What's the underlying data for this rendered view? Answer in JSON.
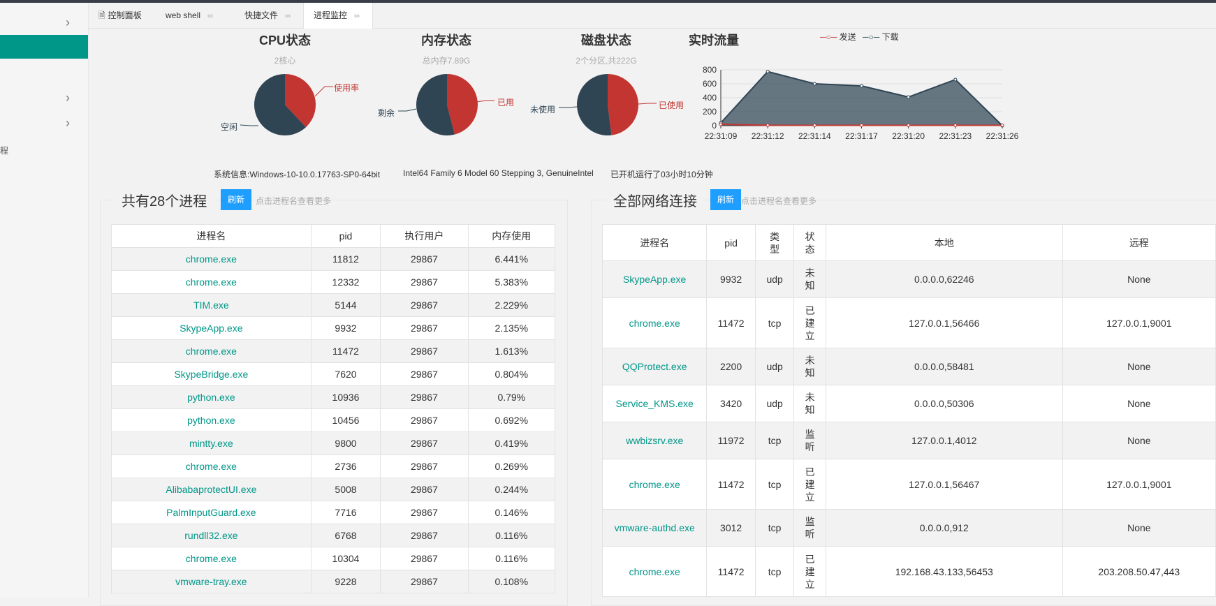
{
  "tabs": [
    {
      "label": "控制面板"
    },
    {
      "label": "web shell"
    },
    {
      "label": "快捷文件"
    },
    {
      "label": "进程监控"
    }
  ],
  "sidebar": {
    "partial_label": "程"
  },
  "cpu": {
    "title": "CPU状态",
    "subtitle": "2核心",
    "used_label": "使用率",
    "free_label": "空闲",
    "used_fraction": 0.38,
    "used_color": "#c23531",
    "free_color": "#2f4554"
  },
  "memory": {
    "title": "内存状态",
    "subtitle": "总内存7.89G",
    "used_label": "已用",
    "free_label": "剩余",
    "used_fraction": 0.46,
    "used_color": "#c23531",
    "free_color": "#2f4554"
  },
  "disk": {
    "title": "磁盘状态",
    "subtitle": "2个分区,共222G",
    "used_label": "已使用",
    "free_label": "未使用",
    "used_fraction": 0.48,
    "used_color": "#c23531",
    "free_color": "#2f4554"
  },
  "traffic": {
    "title": "实时流量",
    "legend_send": "发送",
    "legend_download": "下载"
  },
  "chart_data": {
    "type": "area",
    "x": [
      "22:31:09",
      "22:31:12",
      "22:31:14",
      "22:31:17",
      "22:31:20",
      "22:31:23",
      "22:31:26"
    ],
    "series": [
      {
        "name": "发送",
        "values": [
          20,
          5,
          5,
          5,
          5,
          5,
          5
        ],
        "color": "#c23531"
      },
      {
        "name": "下载",
        "values": [
          40,
          775,
          600,
          570,
          410,
          660,
          0
        ],
        "color": "#2f4554"
      }
    ],
    "yticks": [
      "0",
      "200",
      "400",
      "600",
      "800"
    ],
    "ylim": [
      0,
      800
    ],
    "grid": true,
    "legend": "top"
  },
  "sysinfo": {
    "label": "系统信息:",
    "os": "Windows-10-10.0.17763-SP0-64bit",
    "cpu": "Intel64 Family 6 Model 60 Stepping 3, GenuineIntel",
    "uptime": "已开机运行了03小时10分钟"
  },
  "process_panel": {
    "title": "共有28个进程",
    "refresh": "刷新",
    "hint": "点击进程名查看更多",
    "headers": [
      "进程名",
      "pid",
      "执行用户",
      "内存使用"
    ],
    "rows": [
      [
        "chrome.exe",
        "11812",
        "29867",
        "6.441%"
      ],
      [
        "chrome.exe",
        "12332",
        "29867",
        "5.383%"
      ],
      [
        "TIM.exe",
        "5144",
        "29867",
        "2.229%"
      ],
      [
        "SkypeApp.exe",
        "9932",
        "29867",
        "2.135%"
      ],
      [
        "chrome.exe",
        "11472",
        "29867",
        "1.613%"
      ],
      [
        "SkypeBridge.exe",
        "7620",
        "29867",
        "0.804%"
      ],
      [
        "python.exe",
        "10936",
        "29867",
        "0.79%"
      ],
      [
        "python.exe",
        "10456",
        "29867",
        "0.692%"
      ],
      [
        "mintty.exe",
        "9800",
        "29867",
        "0.419%"
      ],
      [
        "chrome.exe",
        "2736",
        "29867",
        "0.269%"
      ],
      [
        "AlibabaprotectUI.exe",
        "5008",
        "29867",
        "0.244%"
      ],
      [
        "PalmInputGuard.exe",
        "7716",
        "29867",
        "0.146%"
      ],
      [
        "rundll32.exe",
        "6768",
        "29867",
        "0.116%"
      ],
      [
        "chrome.exe",
        "10304",
        "29867",
        "0.116%"
      ],
      [
        "vmware-tray.exe",
        "9228",
        "29867",
        "0.108%"
      ]
    ]
  },
  "network_panel": {
    "title": "全部网络连接",
    "refresh": "刷新",
    "hint": "点击进程名查看更多",
    "headers": [
      "进程名",
      "pid",
      "类型",
      "状态",
      "本地",
      "远程"
    ],
    "rows": [
      [
        "SkypeApp.exe",
        "9932",
        "udp",
        "未知",
        "0.0.0.0,62246",
        "None"
      ],
      [
        "chrome.exe",
        "11472",
        "tcp",
        "已建立",
        "127.0.0.1,56466",
        "127.0.0.1,9001"
      ],
      [
        "QQProtect.exe",
        "2200",
        "udp",
        "未知",
        "0.0.0.0,58481",
        "None"
      ],
      [
        "Service_KMS.exe",
        "3420",
        "udp",
        "未知",
        "0.0.0.0,50306",
        "None"
      ],
      [
        "wwbizsrv.exe",
        "11972",
        "tcp",
        "监听",
        "127.0.0.1,4012",
        "None"
      ],
      [
        "chrome.exe",
        "11472",
        "tcp",
        "已建立",
        "127.0.0.1,56467",
        "127.0.0.1,9001"
      ],
      [
        "vmware-authd.exe",
        "3012",
        "tcp",
        "监听",
        "0.0.0.0,912",
        "None"
      ],
      [
        "chrome.exe",
        "11472",
        "tcp",
        "已建立",
        "192.168.43.133,56453",
        "203.208.50.47,443"
      ]
    ]
  }
}
